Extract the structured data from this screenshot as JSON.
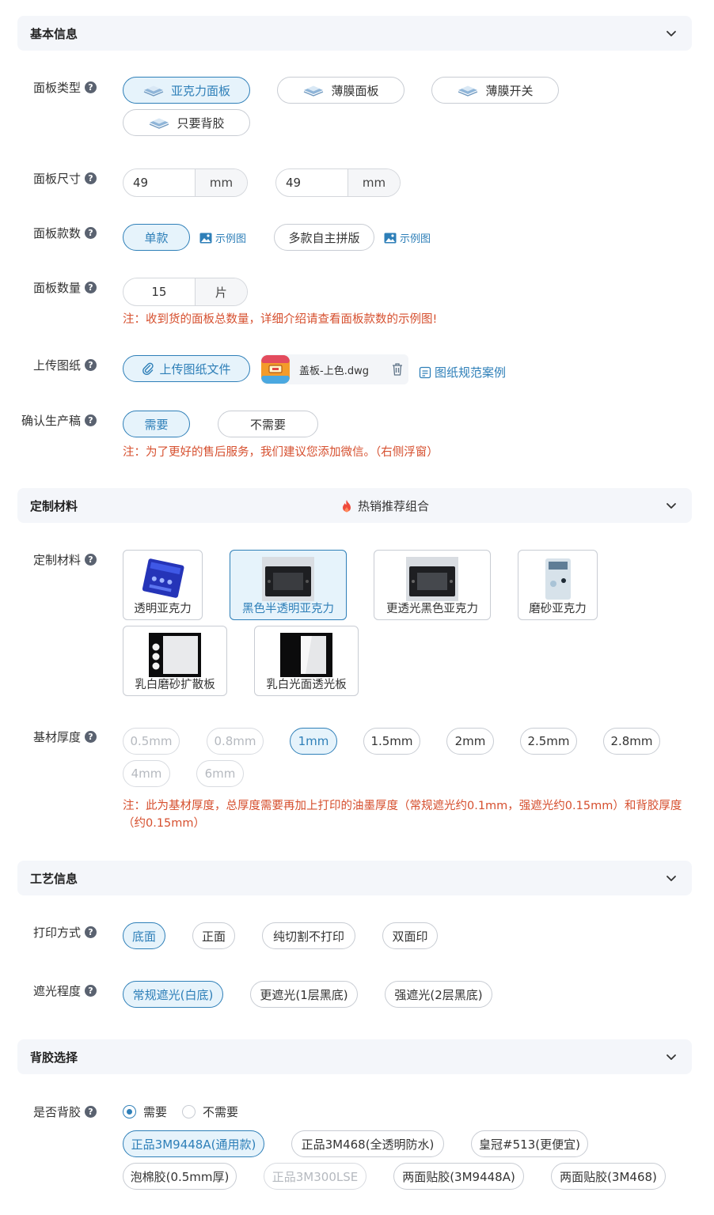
{
  "sections": {
    "basic": "基本信息",
    "material": "定制材料",
    "hot_combo": "热销推荐组合",
    "craft": "工艺信息",
    "adhesive": "背胶选择"
  },
  "labels": {
    "panel_type": "面板类型",
    "panel_size": "面板尺寸",
    "panel_styles": "面板款数",
    "panel_qty": "面板数量",
    "upload": "上传图纸",
    "confirm_proof": "确认生产稿",
    "custom_material": "定制材料",
    "thickness": "基材厚度",
    "print_mode": "打印方式",
    "shading": "遮光程度",
    "adhesive_q": "是否背胶",
    "help": "?"
  },
  "panel_type": {
    "options": [
      "亚克力面板",
      "薄膜面板",
      "薄膜开关",
      "只要背胶"
    ],
    "selected": "亚克力面板"
  },
  "panel_size": {
    "width": "49",
    "height": "49",
    "unit": "mm"
  },
  "panel_styles": {
    "options": [
      "单款",
      "多款自主拼版"
    ],
    "selected": "单款",
    "example_link": "示例图"
  },
  "panel_qty": {
    "value": "15",
    "unit": "片",
    "note": "注：收到货的面板总数量，详细介绍请查看面板款数的示例图!"
  },
  "upload": {
    "button": "上传图纸文件",
    "file_name": "盖板-上色.dwg",
    "spec_link": "图纸规范案例"
  },
  "confirm_proof": {
    "options": [
      "需要",
      "不需要"
    ],
    "selected": "需要",
    "note": "注：为了更好的售后服务，我们建议您添加微信。（右侧浮窗）"
  },
  "materials": {
    "options": [
      "透明亚克力",
      "黑色半透明亚克力",
      "更透光黑色亚克力",
      "磨砂亚克力",
      "乳白磨砂扩散板",
      "乳白光面透光板"
    ],
    "selected": "黑色半透明亚克力"
  },
  "thickness": {
    "options": [
      "0.5mm",
      "0.8mm",
      "1mm",
      "1.5mm",
      "2mm",
      "2.5mm",
      "2.8mm",
      "4mm",
      "6mm"
    ],
    "disabled": [
      "0.5mm",
      "0.8mm",
      "4mm",
      "6mm"
    ],
    "selected": "1mm",
    "note": "注：此为基材厚度，总厚度需要再加上打印的油墨厚度（常规遮光约0.1mm，强遮光约0.15mm）和背胶厚度（约0.15mm）"
  },
  "print_mode": {
    "options": [
      "底面",
      "正面",
      "纯切割不打印",
      "双面印"
    ],
    "selected": "底面"
  },
  "shading": {
    "options": [
      "常规遮光(白底)",
      "更遮光(1层黑底)",
      "强遮光(2层黑底)"
    ],
    "selected": "常规遮光(白底)"
  },
  "adhesive": {
    "radio": [
      "需要",
      "不需要"
    ],
    "radio_selected": "需要",
    "options": [
      "正品3M9448A(通用款)",
      "正品3M468(全透明防水)",
      "皇冠#513(更便宜)",
      "泡棉胶(0.5mm厚)",
      "正品3M300LSE",
      "两面贴胶(3M9448A)",
      "两面贴胶(3M468)"
    ],
    "disabled": [
      "正品3M300LSE"
    ],
    "selected": "正品3M9448A(通用款)"
  },
  "colors": {
    "accent": "#2e7fb8",
    "accent_bg": "#e6f3fb",
    "note": "#d64f2e",
    "header_bg": "#f4f6fa"
  }
}
